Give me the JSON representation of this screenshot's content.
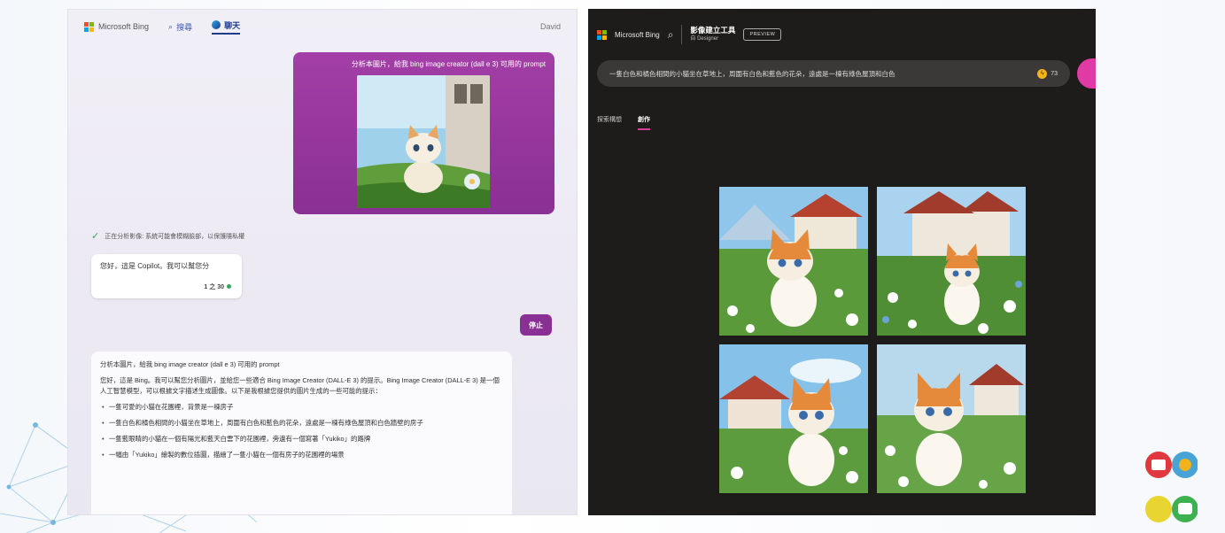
{
  "left": {
    "brand": "Microsoft Bing",
    "tabs": [
      {
        "label": "搜尋",
        "icon": "search-icon"
      },
      {
        "label": "聊天",
        "icon": "chat-icon"
      }
    ],
    "user": "David",
    "user_message": "分析本圖片，給我 bing image creator (dall e 3) 可用的 prompt",
    "status": "正在分析影像: 系統可能會模糊臉部，以保護隱私權",
    "bot_greeting": "您好，這是 Copilot。我可以幫您分",
    "counter": "1 之 30",
    "stop_button": "停止",
    "answer": {
      "question": "分析本圖片，給我 bing image creator (dall e 3) 可用的 prompt",
      "intro": "您好，這是 Bing。我可以幫您分析圖片，並給您一些適合 Bing Image Creator (DALL-E 3) 的提示。Bing Image Creator (DALL-E 3) 是一個人工智慧模型，可以根據文字描述生成圖像。以下是我根據您提供的圖片生成的一些可能的提示：",
      "bullets": [
        "一隻可愛的小貓在花園裡，背景是一棟房子",
        "一隻白色和橘色相間的小貓坐在草地上，周圍有白色和藍色的花朵，遠處是一棟有綠色屋頂和白色牆壁的房子",
        "一隻藍眼睛的小貓在一個有陽光和藍天白雲下的花園裡，旁邊有一個寫著「Yukiko」的路牌",
        "一幅由「Yukiko」繪製的數位插圖，描繪了一隻小貓在一個有房子的花園裡的場景"
      ]
    }
  },
  "right": {
    "brand": "Microsoft Bing",
    "tool_title": "影像建立工具",
    "tool_subtitle": "自 Designer",
    "preview_label": "PREVIEW",
    "prompt": "一隻白色和橘色相間的小貓坐在草地上，周圍有白色和藍色的花朵，遠處是一棟有綠色屋頂和白色",
    "coins": "73",
    "tabs": [
      {
        "label": "探索構想",
        "active": false
      },
      {
        "label": "創作",
        "active": true
      }
    ],
    "images": [
      {
        "icon": "generated-cat-image-1"
      },
      {
        "icon": "generated-cat-image-2"
      },
      {
        "icon": "generated-cat-image-3"
      },
      {
        "icon": "generated-cat-image-4"
      }
    ]
  },
  "colors": {
    "accent_purple": "#8a2f94",
    "dark_bg": "#1d1c1b",
    "pink_button": "#e23aa5",
    "coin": "#f2b21c"
  }
}
